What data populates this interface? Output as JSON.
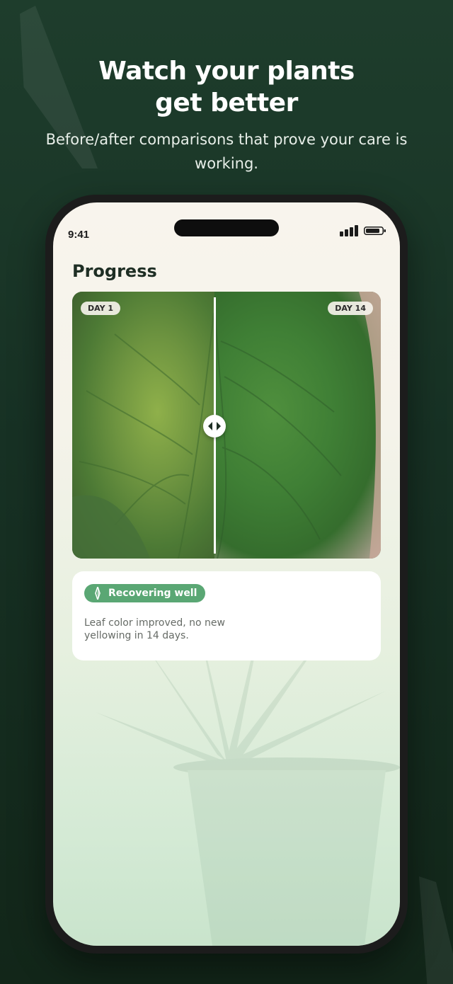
{
  "hero": {
    "title_line1": "Watch your plants",
    "title_line2": "get better",
    "subtitle": "Before/after comparisons that prove your care is working."
  },
  "status_bar": {
    "time": "9:41",
    "signal_icon": "signal-bars-icon",
    "battery_icon": "battery-icon"
  },
  "screen": {
    "title": "Progress",
    "comparison": {
      "before_label": "DAY 1",
      "after_label": "DAY 14",
      "slider_position": 0.46,
      "handle_icon": "left-right-arrows-icon"
    },
    "status_card": {
      "pill_label": "Recovering well",
      "pill_icon": "sparkle-icon",
      "description": "Leaf color improved, no new yellowing in 14 days."
    }
  },
  "colors": {
    "background": "#1a3627",
    "accent_green": "#5aa774",
    "title_text": "#1e2e24"
  }
}
